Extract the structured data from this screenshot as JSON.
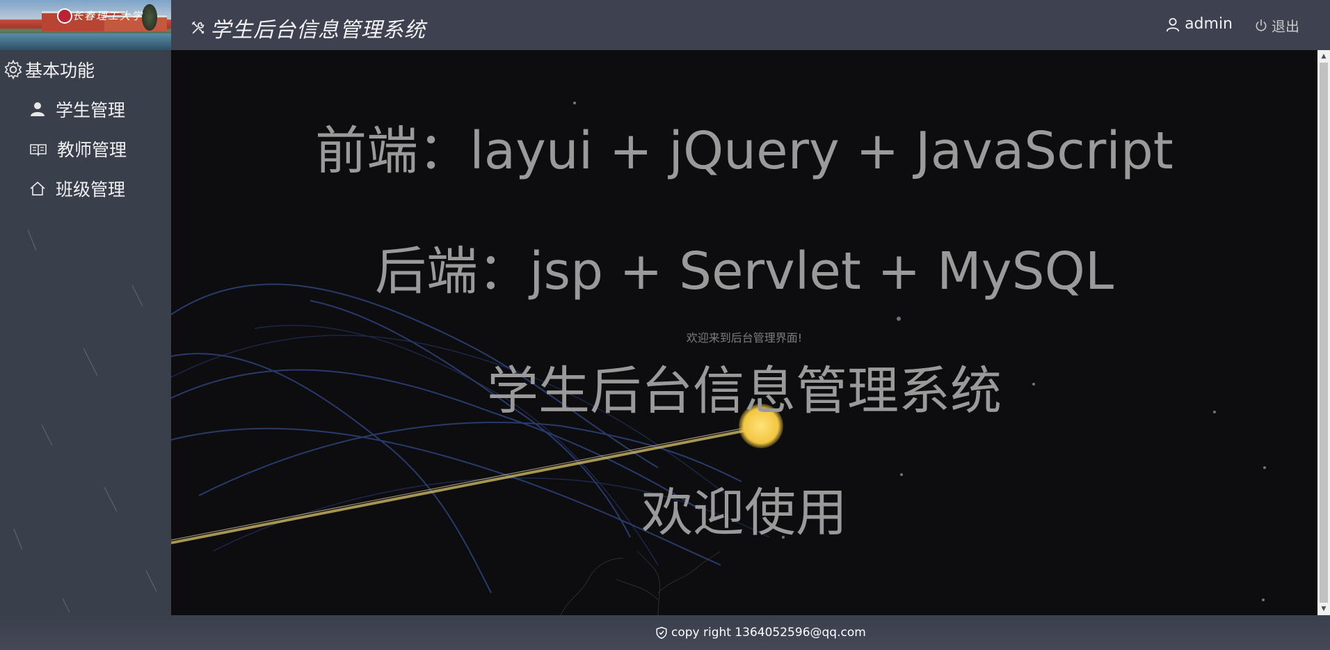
{
  "header": {
    "title": "学生后台信息管理系统",
    "user": "admin",
    "logout_label": "退出"
  },
  "logo": {
    "brand": "长春理工大学"
  },
  "sidebar": {
    "group_label": "基本功能",
    "items": [
      {
        "label": "学生管理",
        "icon": "user-icon"
      },
      {
        "label": "教师管理",
        "icon": "book-icon"
      },
      {
        "label": "班级管理",
        "icon": "home-icon"
      }
    ]
  },
  "main": {
    "frontend_line": "前端：layui + jQuery + JavaScript",
    "backend_line": "后端：jsp + Servlet + MySQL",
    "welcome_small": "欢迎来到后台管理界面!",
    "system_name": "学生后台信息管理系统",
    "welcome_use": "欢迎使用"
  },
  "footer": {
    "copyright": "copy right 1364052596@qq.com"
  },
  "colors": {
    "header_bg": "#3d4150",
    "sidebar_bg": "#3a3f4c",
    "main_bg": "#0d0d10",
    "text_gray": "#9a9a9a",
    "accent_yellow": "#f2c640"
  }
}
